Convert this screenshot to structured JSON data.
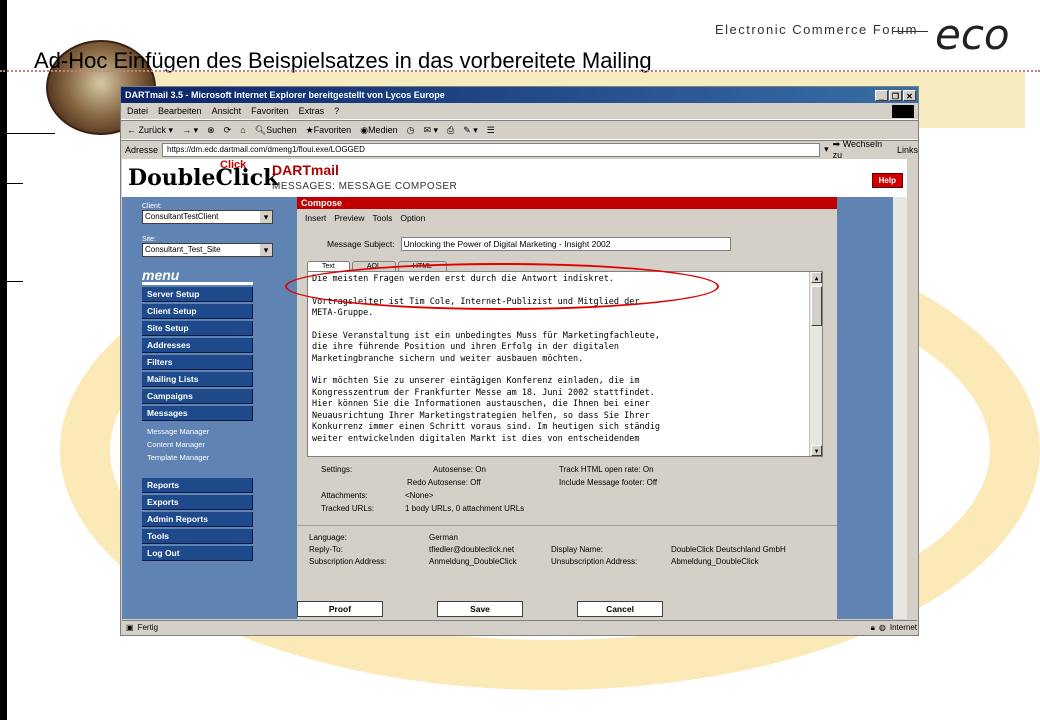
{
  "slide": {
    "title": "Ad-Hoc Einfügen des Beispielsatzes in das vorbereitete Mailing",
    "brand_sub": "Electronic Commerce Forum",
    "brand_logo": "eco"
  },
  "browser": {
    "title": "DARTmail 3.5 - Microsoft Internet Explorer bereitgestellt von Lycos Europe",
    "menu": [
      "Datei",
      "Bearbeiten",
      "Ansicht",
      "Favoriten",
      "Extras",
      "?"
    ],
    "toolbar": {
      "back": "Zurück",
      "search": "Suchen",
      "favorites": "Favoriten",
      "media": "Medien"
    },
    "address_label": "Adresse",
    "address": "https://dm.edc.dartmail.com/dmeng1/floui.exe/LOGGED",
    "go": "Wechseln zu",
    "links": "Links",
    "status": "Fertig",
    "zone": "Internet"
  },
  "app": {
    "logo": "DoubleClick",
    "logo_click": "Click",
    "product": "DARTmail",
    "section": "MESSAGES: MESSAGE COMPOSER",
    "help": "Help",
    "client_label": "Client:",
    "client_value": "ConsultantTestClient",
    "site_label": "Site:",
    "site_value": "Consultant_Test_Site",
    "menu_header": "menu",
    "menu_top": [
      "Server Setup",
      "Client Setup",
      "Site Setup",
      "Addresses",
      "Filters",
      "Mailing Lists",
      "Campaigns",
      "Messages"
    ],
    "menu_sub": [
      "Message Manager",
      "Content Manager",
      "Template Manager"
    ],
    "menu_bottom": [
      "Reports",
      "Exports",
      "Admin Reports",
      "Tools",
      "Log Out"
    ]
  },
  "compose": {
    "header": "Compose",
    "menu": [
      "Insert",
      "Preview",
      "Tools",
      "Option"
    ],
    "subject_label": "Message Subject:",
    "subject_value": "Unlocking the Power of Digital Marketing - Insight 2002",
    "tabs": [
      "Text",
      "AOL",
      "HTML"
    ],
    "body": [
      "Die meisten Fragen werden erst durch die Antwort indiskret.",
      "Vortragsleiter ist Tim Cole, Internet-Publizist und Mitglied der\nMETA-Gruppe.",
      "Diese Veranstaltung ist ein unbedingtes Muss für Marketingfachleute,\ndie ihre führende Position und ihren Erfolg in der digitalen\nMarketingbranche sichern und weiter ausbauen möchten.",
      "Wir möchten Sie zu unserer eintägigen Konferenz einladen, die im\nKongresszentrum der Frankfurter Messe am 18. Juni 2002 stattfindet.\nHier können Sie die Informationen austauschen, die Ihnen bei einer\nNeuausrichtung Ihrer Marketingstrategien helfen, so dass Sie Ihrer\nKonkurrenz immer einen Schritt voraus sind. Im heutigen sich ständig\nweiter entwickelnden digitalen Markt ist dies von entscheidendem"
    ],
    "settings_label": "Settings:",
    "autosense": "Autosense: On",
    "redo_autosense": "Redo Autosense: Off",
    "track_html": "Track HTML open rate: On",
    "include_footer": "Include Message footer: Off",
    "attachments_label": "Attachments:",
    "attachments_value": "<None>",
    "tracked_label": "Tracked URLs:",
    "tracked_value": "1 body URLs, 0 attachment URLs",
    "language_label": "Language:",
    "language_value": "German",
    "reply_label": "Reply-To:",
    "reply_value": "tfiedler@doubleclick.net",
    "display_label": "Display Name:",
    "display_value": "DoubleClick Deutschland GmbH",
    "sub_label": "Subscription Address:",
    "sub_value": "Anmeldung_DoubleClick",
    "unsub_label": "Unsubscription Address:",
    "unsub_value": "Abmeldung_DoubleClick",
    "buttons": [
      "Proof",
      "Save",
      "Cancel"
    ]
  }
}
